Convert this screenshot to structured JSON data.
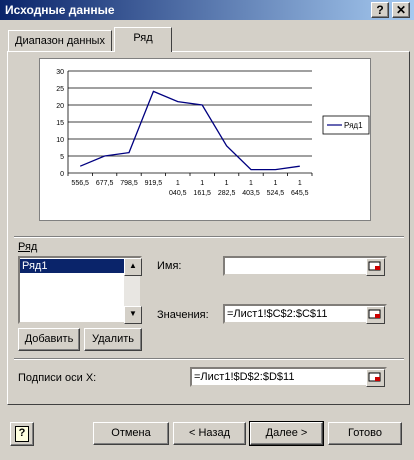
{
  "window": {
    "title": "Исходные данные",
    "help_btn": "?",
    "close_btn": "✕"
  },
  "tabs": [
    {
      "label": "Диапазон данных"
    },
    {
      "label": "Ряд"
    }
  ],
  "chart_data": {
    "type": "line",
    "x": [
      "556,5",
      "677,5",
      "798,5",
      "919,5",
      "1 040,5",
      "1 161,5",
      "1 282,5",
      "1 403,5",
      "1 524,5",
      "1 645,5"
    ],
    "x_top": [
      "556,5",
      "677,5",
      "798,5",
      "919,5",
      "1",
      "1",
      "1",
      "1",
      "1",
      "1"
    ],
    "x_bottom": [
      "",
      "",
      "",
      "",
      "040,5",
      "161,5",
      "282,5",
      "403,5",
      "524,5",
      "645,5"
    ],
    "series": [
      {
        "name": "Ряд1",
        "values": [
          2,
          5,
          6,
          24,
          21,
          20,
          8,
          1,
          1,
          2
        ]
      }
    ],
    "ylim": [
      0,
      30
    ],
    "yticks": [
      "0",
      "5",
      "10",
      "15",
      "20",
      "25",
      "30"
    ],
    "legend": "right",
    "grid": true,
    "line_color": "#000080"
  },
  "series_section": {
    "label": "Ряд",
    "items": [
      "Ряд1"
    ],
    "add_btn": "Добавить",
    "remove_btn": "Удалить",
    "name_label": "Имя:",
    "name_value": "",
    "values_label": "Значения:",
    "values_value": "=Лист1!$C$2:$C$11"
  },
  "x_axis_section": {
    "label": "Подписи оси X:",
    "value": "=Лист1!$D$2:$D$11"
  },
  "footer": {
    "cancel": "Отмена",
    "back": "< Назад",
    "next": "Далее >",
    "finish": "Готово",
    "help_icon": "?"
  }
}
